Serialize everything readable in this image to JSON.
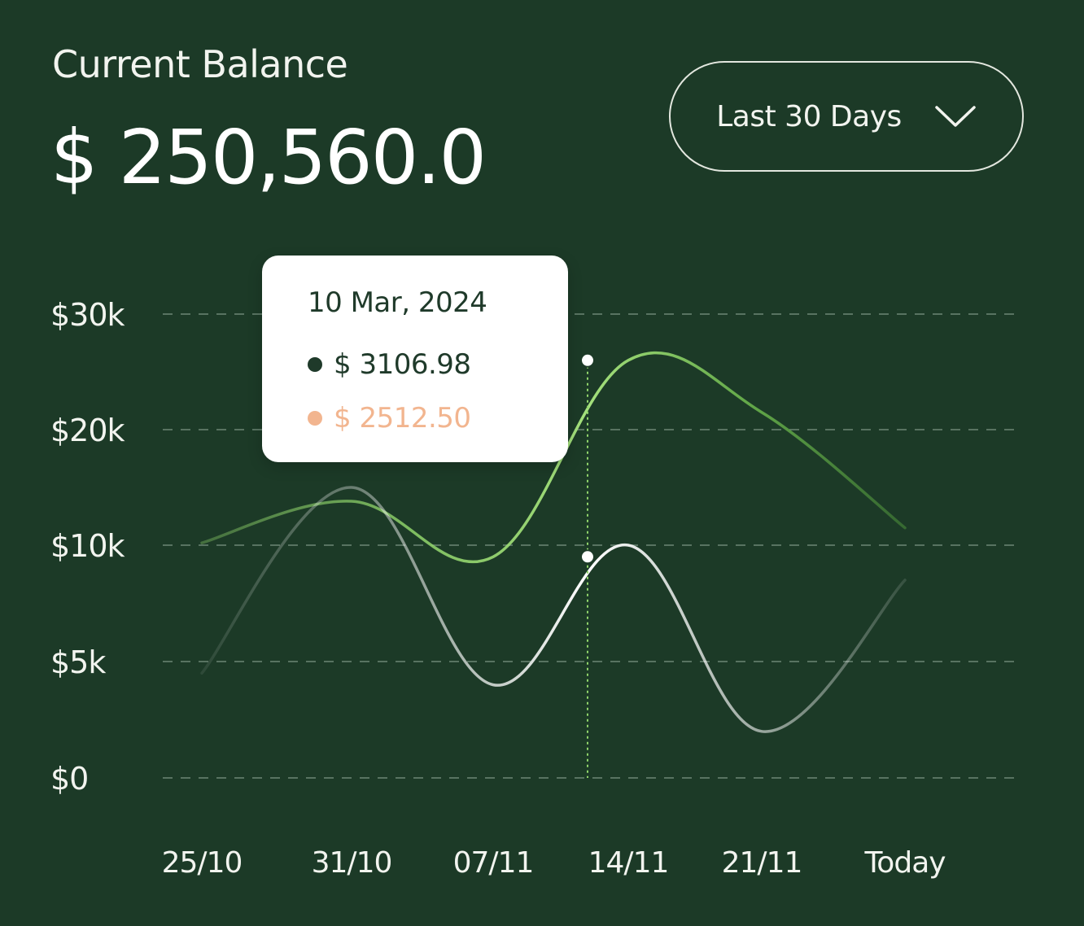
{
  "header": {
    "title": "Current Balance",
    "balance": "$ 250,560.0"
  },
  "range_selector": {
    "selected": "Last 30 Days",
    "icon": "chevron-down-icon"
  },
  "tooltip": {
    "date": "10 Mar, 2024",
    "rows": [
      {
        "value": "$ 3106.98",
        "color": "#1f3a2a"
      },
      {
        "value": "$ 2512.50",
        "color": "#f2b58f"
      }
    ]
  },
  "colors": {
    "background": "#1c3a27",
    "series_green": "#8fd36a",
    "series_white": "#ffffff",
    "grid": "#8aa392",
    "tooltip_bg": "#ffffff",
    "accent_peach": "#f2b58f"
  },
  "chart_data": {
    "type": "line",
    "title": "",
    "xlabel": "",
    "ylabel": "",
    "y_tick_labels": [
      "$0",
      "$5k",
      "$10k",
      "$20k",
      "$30k"
    ],
    "y_tick_values": [
      0,
      5000,
      10000,
      20000,
      30000
    ],
    "x_tick_labels": [
      "25/10",
      "31/10",
      "07/11",
      "14/11",
      "21/11",
      "Today"
    ],
    "grid": true,
    "legend": "none",
    "highlight": {
      "near_x_label": "14/11",
      "values": [
        26000,
        9500
      ]
    },
    "series": [
      {
        "color": "#8fd36a",
        "points": [
          {
            "x": "25/10",
            "y": 10200
          },
          {
            "x": "31/10",
            "y": 13800
          },
          {
            "x": "07/11",
            "y": 9500
          },
          {
            "x": "14/11",
            "y": 26000
          },
          {
            "x": "21/11",
            "y": 21500
          },
          {
            "x": "Today",
            "y": 11500
          }
        ]
      },
      {
        "color": "#ffffff",
        "points": [
          {
            "x": "25/10",
            "y": 4500
          },
          {
            "x": "31/10",
            "y": 15000
          },
          {
            "x": "07/11",
            "y": 4000
          },
          {
            "x": "14/11",
            "y": 10000
          },
          {
            "x": "21/11",
            "y": 2000
          },
          {
            "x": "Today",
            "y": 8500
          }
        ]
      }
    ]
  }
}
